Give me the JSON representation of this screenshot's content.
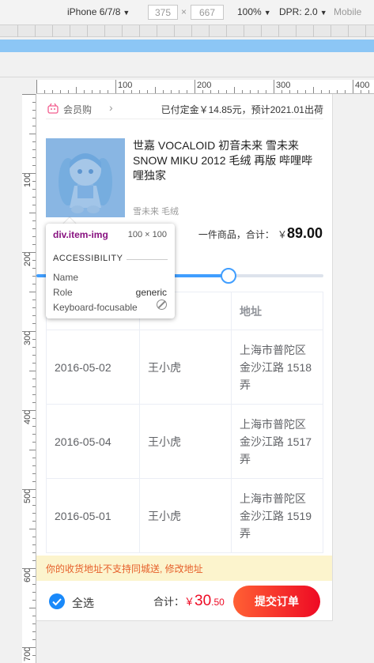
{
  "devtools": {
    "device": "iPhone 6/7/8",
    "width": "375",
    "times": "×",
    "height": "667",
    "zoom": "100%",
    "dpr": "DPR: 2.0",
    "mode": "Mobile"
  },
  "ruler": {
    "h_labels": [
      "100",
      "200",
      "300",
      "400"
    ],
    "v_labels": [
      "100",
      "200",
      "300",
      "400",
      "500",
      "600",
      "700"
    ]
  },
  "store": {
    "name": "会员购",
    "chevron": "›",
    "info": "已付定金￥14.85元，预计2021.01出荷"
  },
  "item": {
    "title": "世嘉 VOCALOID 初音未来 雪未来 SNOW MIKU 2012 毛绒 再版 哔哩哔哩独家",
    "sku": "雪未来 毛绒",
    "count_text": "一件商品，合计：",
    "currency": "￥",
    "price": "89.00"
  },
  "slider": {
    "value": 0.67
  },
  "inspector": {
    "selector": "div.item-img",
    "size": "100 × 100",
    "section": "ACCESSIBILITY",
    "name_label": "Name",
    "role_label": "Role",
    "role_value": "generic",
    "focus_label": "Keyboard-focusable"
  },
  "table": {
    "columns": [
      "",
      "",
      "地址"
    ],
    "rows": [
      {
        "date": "2016-05-02",
        "name": "王小虎",
        "address": "上海市普陀区金沙江路 1518 弄"
      },
      {
        "date": "2016-05-04",
        "name": "王小虎",
        "address": "上海市普陀区金沙江路 1517 弄"
      },
      {
        "date": "2016-05-01",
        "name": "王小虎",
        "address": "上海市普陀区金沙江路 1519 弄"
      }
    ]
  },
  "notice": "你的收货地址不支持同城送, 修改地址",
  "submit_bar": {
    "select_all": "全选",
    "total_label": "合计：",
    "currency": "￥",
    "total_int": "30",
    "total_dec": ".50",
    "button": "提交订单"
  }
}
